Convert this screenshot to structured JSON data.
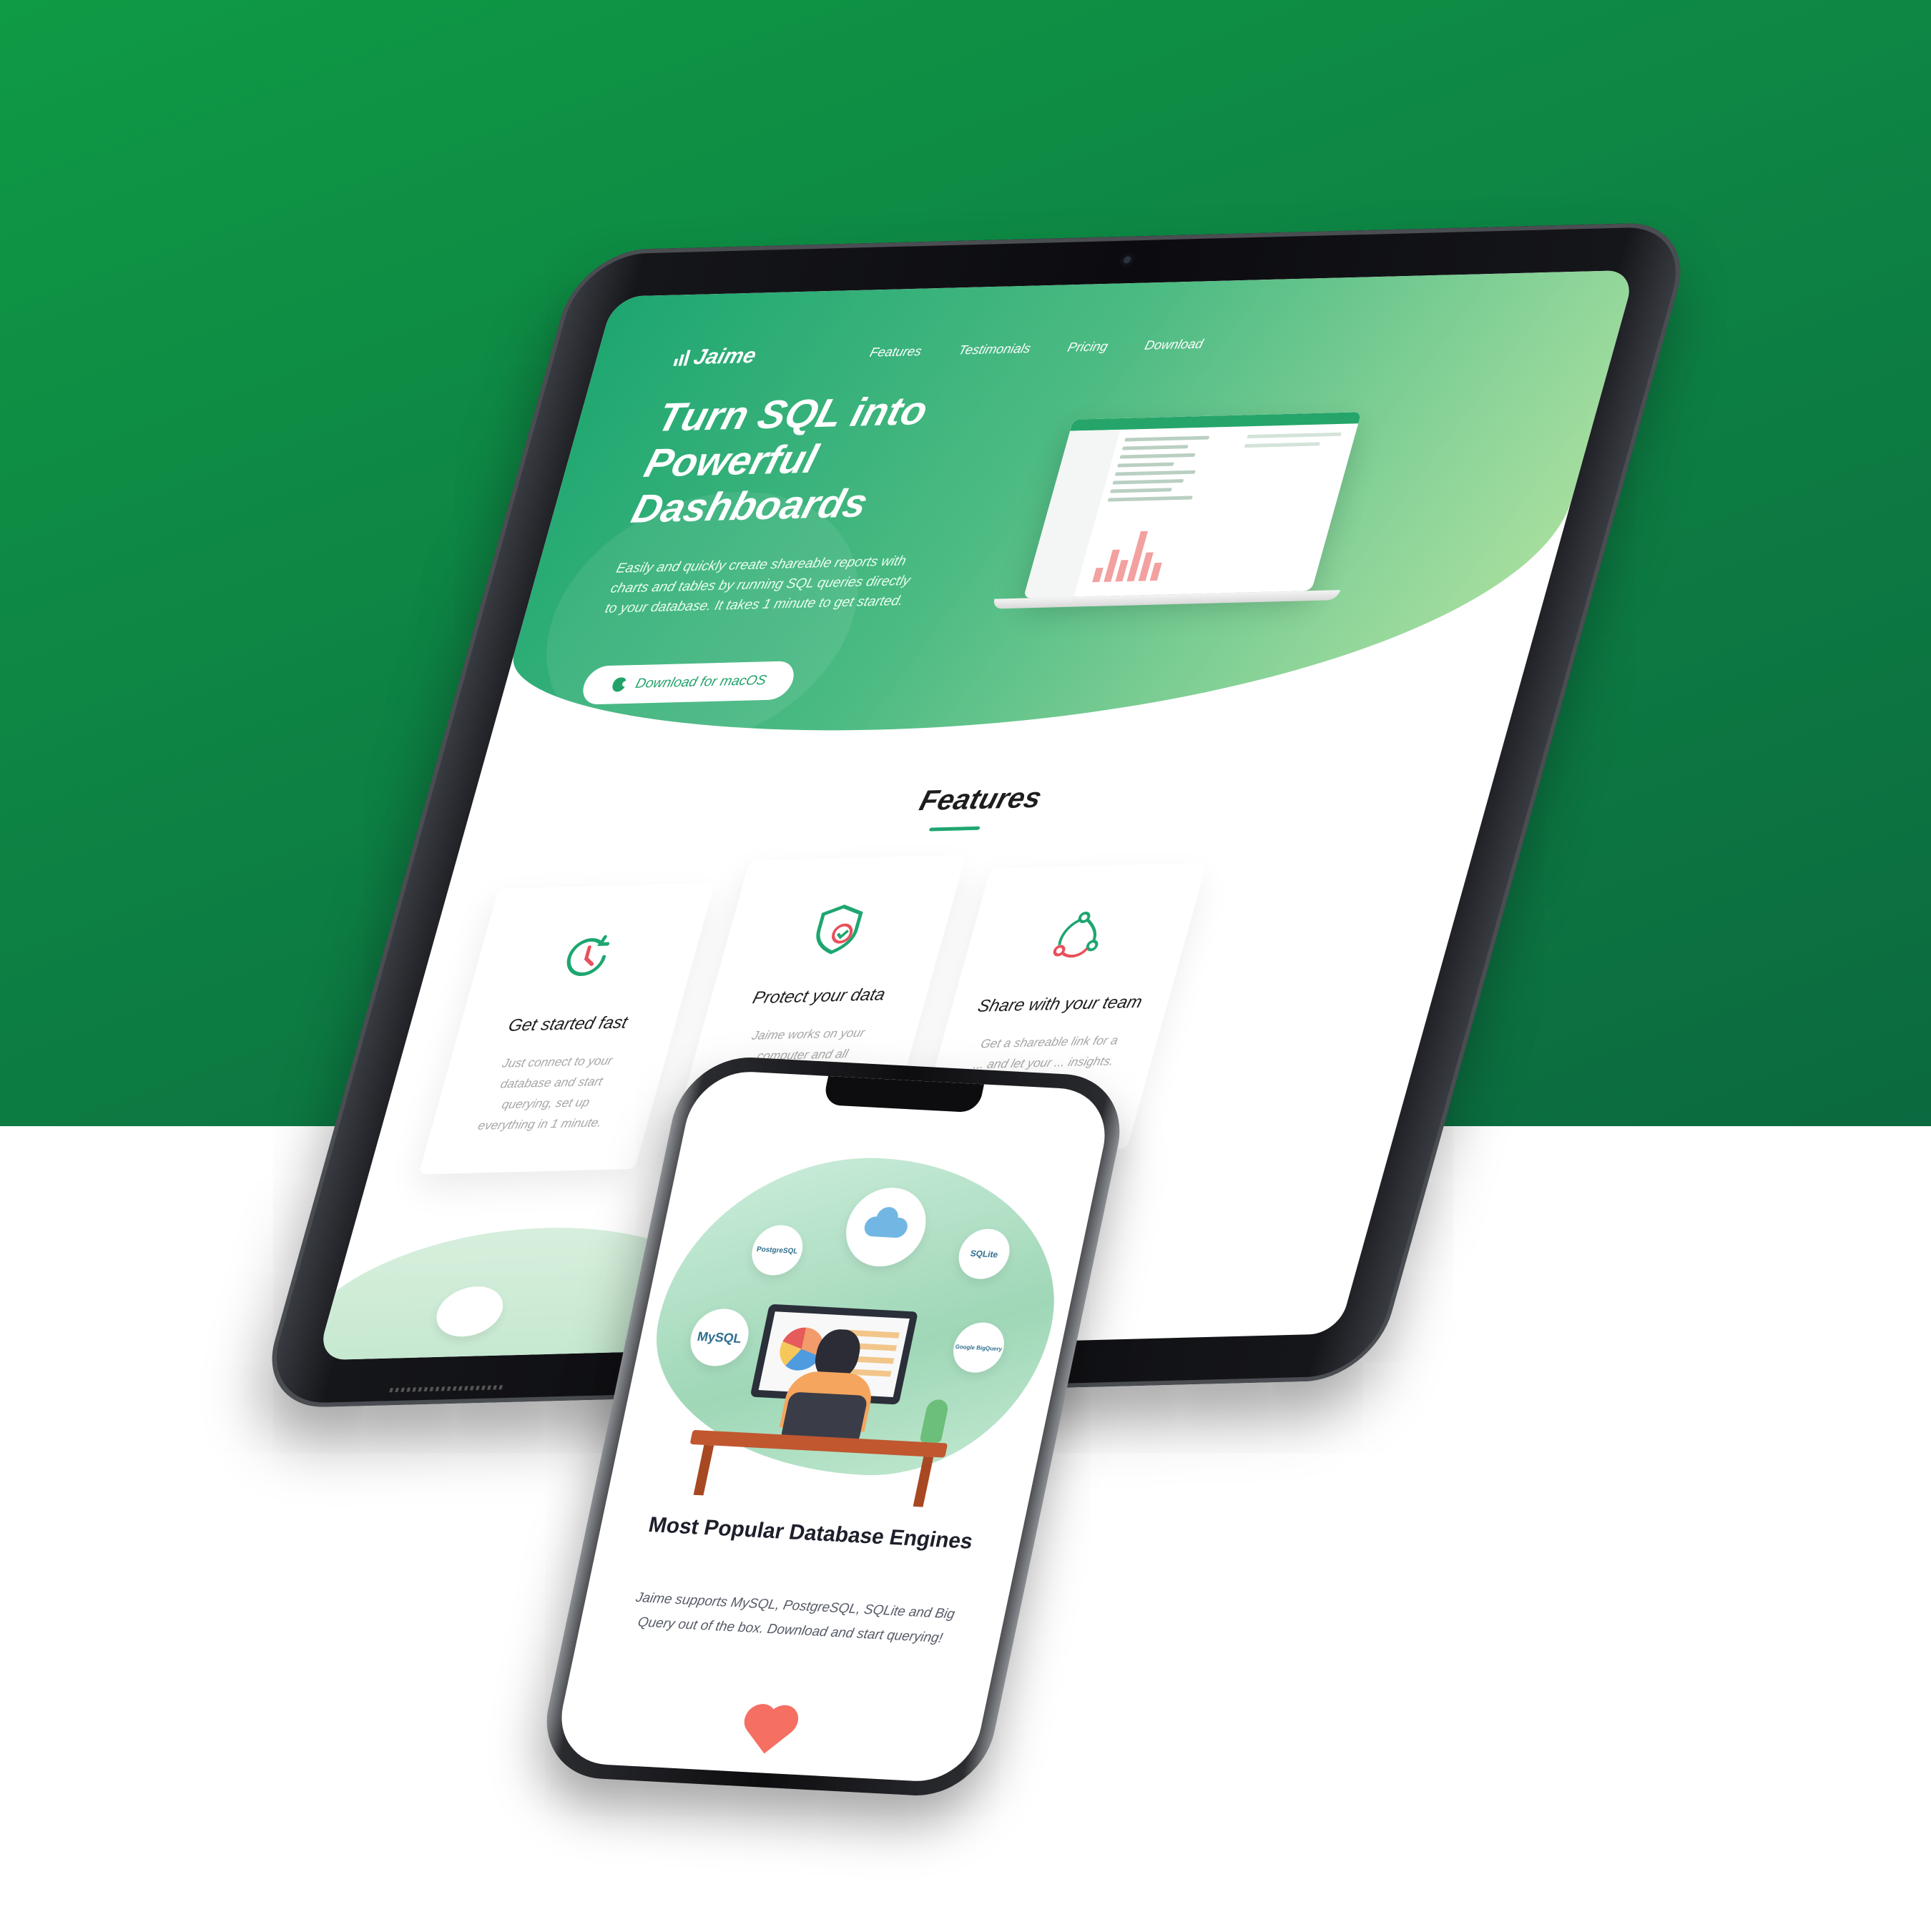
{
  "tablet": {
    "logo": "Jaime",
    "nav": [
      "Features",
      "Testimonials",
      "Pricing",
      "Download"
    ],
    "hero_title": "Turn SQL into Powerful Dashboards",
    "hero_subtitle": "Easily and quickly create shareable reports with charts and tables by running SQL queries directly to your database. It takes 1 minute to get started.",
    "hero_button": "Download for macOS",
    "features_heading": "Features",
    "features": [
      {
        "title": "Get started fast",
        "body": "Just connect to your database and start querying, set up everything in 1 minute.",
        "icon": "clock-refresh-icon"
      },
      {
        "title": "Protect your data",
        "body": "Jaime works on your computer and all connections to the",
        "icon": "shield-check-icon"
      },
      {
        "title": "Share with your team",
        "body": "Get a shareable link for a ... and let your ... insights.",
        "icon": "share-link-icon"
      }
    ]
  },
  "phone": {
    "db_labels": [
      "MySQL",
      "PostgreSQL",
      "SQLite",
      "Google BigQuery"
    ],
    "title": "Most Popular Database Engines",
    "body": "Jaime supports MySQL, PostgreSQL, SQLite and Big Query out of the box. Download and start querying!"
  },
  "colors": {
    "background_green": "#0f9a45",
    "brand_green": "#1ea670",
    "heart": "#f56f63"
  }
}
